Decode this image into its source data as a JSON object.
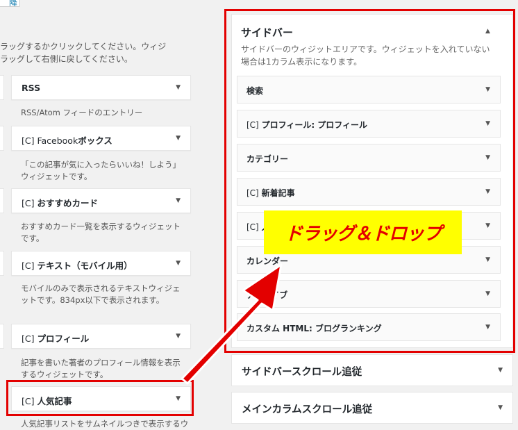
{
  "top_button": {
    "label": "降"
  },
  "intro": {
    "line1": "ラッグするかクリックしてください。ウィジ",
    "line2": "ラッグして右側に戻してください。"
  },
  "available_widgets": [
    {
      "title": "RSS",
      "desc": "RSS/Atom フィードのエントリー"
    },
    {
      "prefix": "[C] Facebook",
      "title": "ボックス",
      "desc": "「この記事が気に入ったらいいね！しよう」ウィジェットです。"
    },
    {
      "prefix": "[C] ",
      "title": "おすすめカード",
      "desc": "おすすめカード一覧を表示するウィジェットです。"
    },
    {
      "prefix": "[C] ",
      "title": "テキスト（モバイル用）",
      "desc": "モバイルのみで表示されるテキストウィジェットです。834px以下で表示されます。"
    },
    {
      "prefix": "[C] ",
      "title": "プロフィール",
      "desc": "記事を書いた著者のプロフィール情報を表示するウィジェットです。"
    },
    {
      "prefix": "[C] ",
      "title": "人気記事",
      "desc": "人気記事リストをサムネイルつきで表示するウ"
    }
  ],
  "sidebar": {
    "title": "サイドバー",
    "description": "サイドバーのウィジットエリアです。ウィジェットを入れていない場合は1カラム表示になります。",
    "widgets": [
      {
        "prefix": "",
        "title": "検索"
      },
      {
        "prefix": "[C] ",
        "title": "プロフィール: プロフィール"
      },
      {
        "prefix": "",
        "title": "カテゴリー"
      },
      {
        "prefix": "[C] ",
        "title": "新着記事"
      },
      {
        "prefix": "[C] ",
        "title": "人"
      },
      {
        "prefix": "",
        "title": "カレンダー"
      },
      {
        "prefix": "",
        "title": "アーカイブ"
      },
      {
        "prefix": "",
        "title": "カスタム HTML: ブログランキング"
      }
    ]
  },
  "other_areas": [
    {
      "title": "サイドバースクロール追従"
    },
    {
      "title": "メインカラムスクロール追従"
    }
  ],
  "annotation": {
    "label": "ドラッグ＆ドロップ"
  },
  "icons": {
    "expand": "▼",
    "collapse": "▲"
  },
  "colors": {
    "highlight": "#e30000",
    "label_bg": "#ffff00"
  }
}
